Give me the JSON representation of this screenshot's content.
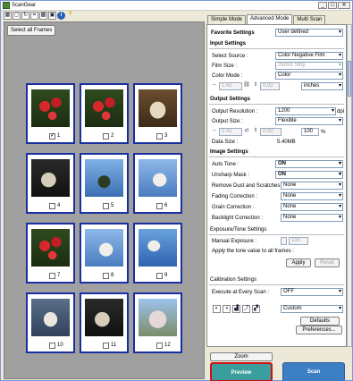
{
  "window": {
    "title": "ScanGear",
    "close": "✕",
    "minimize": "_",
    "maximize": "□"
  },
  "toolbar_icons": [
    "thumbnail-icon",
    "whole-image-icon",
    "rotate-icon",
    "crop-icon",
    "select-all-icon",
    "zoom-icon",
    "info-icon",
    "help-icon"
  ],
  "left": {
    "select_all_label": "Select all Frames"
  },
  "frames": [
    {
      "num": "1",
      "checked": true,
      "scene": "flowers-red"
    },
    {
      "num": "2",
      "checked": false,
      "scene": "flowers-red"
    },
    {
      "num": "3",
      "checked": false,
      "scene": "cat-portrait"
    },
    {
      "num": "4",
      "checked": false,
      "scene": "cat-dark"
    },
    {
      "num": "5",
      "checked": false,
      "scene": "sky-tree"
    },
    {
      "num": "6",
      "checked": false,
      "scene": "cat-sky"
    },
    {
      "num": "7",
      "checked": false,
      "scene": "flowers-red"
    },
    {
      "num": "8",
      "checked": false,
      "scene": "cat-sky"
    },
    {
      "num": "9",
      "checked": false,
      "scene": "sky-cat"
    },
    {
      "num": "10",
      "checked": false,
      "scene": "cat-field"
    },
    {
      "num": "11",
      "checked": false,
      "scene": "cat-dark"
    },
    {
      "num": "12",
      "checked": false,
      "scene": "tree-blossom"
    }
  ],
  "tabs": {
    "simple": "Simple Mode",
    "advanced": "Advanced Mode",
    "multi": "Multi Scan"
  },
  "settings": {
    "favorite_label": "Favorite Settings",
    "favorite_value": "User defined",
    "input_header": "Input Settings",
    "select_source_label": "Select Source :",
    "select_source_value": "Color Negative Film",
    "film_size_label": "Film Size :",
    "film_size_value": "35mm Strip",
    "color_mode_label": "Color Mode :",
    "color_mode_value": "Color",
    "input_w": "1.42",
    "input_h": "0.92",
    "input_unit": "inches",
    "output_header": "Output Settings",
    "output_res_label": "Output Resolution :",
    "output_res_value": "1200",
    "output_res_unit": "dpi",
    "output_size_label": "Output Size :",
    "output_size_value": "Flexible",
    "output_w": "1.42",
    "output_h": "0.92",
    "output_pct": "100",
    "output_pct_unit": "%",
    "data_size_label": "Data Size :",
    "data_size_value": "5.40MB",
    "image_header": "Image Settings",
    "auto_tone_label": "Auto Tone :",
    "auto_tone_value": "ON",
    "unsharp_label": "Unsharp Mask :",
    "unsharp_value": "ON",
    "dust_label": "Remove Dust and Scratches :",
    "dust_value": "None",
    "fading_label": "Fading Correction :",
    "fading_value": "None",
    "grain_label": "Grain Correction :",
    "grain_value": "None",
    "backlight_label": "Backlight Correction :",
    "backlight_value": "None",
    "exposure_header": "Exposure/Tone Settings",
    "manual_exposure_label": "Manual Exposure :",
    "manual_exposure_value": "100",
    "apply_all_label": "Apply the tone value to all frames :",
    "apply_btn": "Apply",
    "reset_btn": "Reset",
    "calibration_header": "Calibration Settings",
    "execute_label": "Execute at Every Scan :",
    "execute_value": "OFF",
    "custom_value": "Custom",
    "defaults_btn": "Defaults",
    "preferences_btn": "Preferences..."
  },
  "bottom": {
    "zoom_btn": "Zoom",
    "preview_btn": "Preview",
    "scan_btn": "Scan"
  }
}
